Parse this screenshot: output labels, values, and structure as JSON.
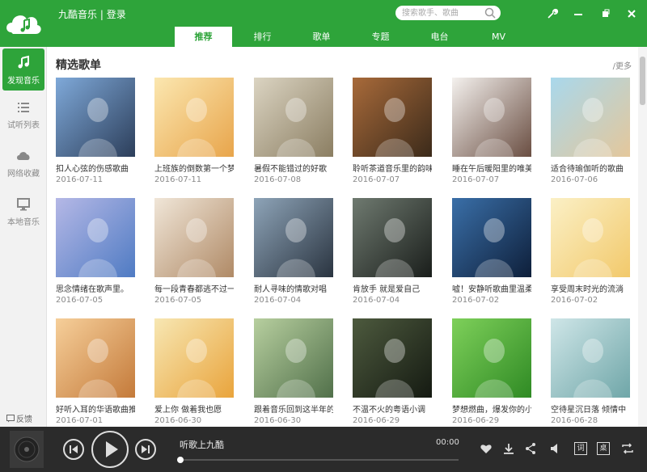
{
  "app": {
    "title": "九酷音乐",
    "login": "登录",
    "search_placeholder": "搜索歌手、歌曲",
    "accent": "#2ea43a"
  },
  "tabs": [
    {
      "label": "推荐",
      "active": true
    },
    {
      "label": "排行",
      "active": false
    },
    {
      "label": "歌单",
      "active": false
    },
    {
      "label": "专题",
      "active": false
    },
    {
      "label": "电台",
      "active": false
    },
    {
      "label": "MV",
      "active": false
    }
  ],
  "sidebar": {
    "items": [
      {
        "label": "发现音乐",
        "icon": "music-note-icon",
        "active": true
      },
      {
        "label": "试听列表",
        "icon": "list-icon",
        "active": false
      },
      {
        "label": "网络收藏",
        "icon": "cloud-icon",
        "active": false
      },
      {
        "label": "本地音乐",
        "icon": "monitor-icon",
        "active": false
      }
    ],
    "feedback": "反馈"
  },
  "main": {
    "section_title": "精选歌单",
    "more": "/更多",
    "playlists": [
      {
        "title": "扣人心弦的伤感歌曲",
        "date": "2016-07-11",
        "c1": "#7fa9d9",
        "c2": "#2c3e5a"
      },
      {
        "title": "上班族的倒数第一个梦",
        "date": "2016-07-11",
        "c1": "#fbe7b0",
        "c2": "#e8a54b"
      },
      {
        "title": "暑假不能错过的好歌",
        "date": "2016-07-08",
        "c1": "#dbd4c2",
        "c2": "#8b7e62"
      },
      {
        "title": "聆听茶道音乐里的韵味",
        "date": "2016-07-07",
        "c1": "#a86a3a",
        "c2": "#3b2a1a"
      },
      {
        "title": "睡在午后暖阳里的唯美",
        "date": "2016-07-07",
        "c1": "#f4f1ee",
        "c2": "#6a4e42"
      },
      {
        "title": "适合待瑜伽听的歌曲",
        "date": "2016-07-06",
        "c1": "#a9d8ec",
        "c2": "#e4c79b"
      },
      {
        "title": "思念情绪在歌声里。",
        "date": "2016-07-05",
        "c1": "#b5b8e6",
        "c2": "#4f7bc3"
      },
      {
        "title": "每一段青春都逃不过一",
        "date": "2016-07-05",
        "c1": "#f0e6d8",
        "c2": "#b08a66"
      },
      {
        "title": "耐人寻味的情歌对唱",
        "date": "2016-07-04",
        "c1": "#8ea4b8",
        "c2": "#2a3440"
      },
      {
        "title": "肯放手 就是爱自己",
        "date": "2016-07-04",
        "c1": "#6f7a70",
        "c2": "#1a1e1b"
      },
      {
        "title": "嘘！安静听歌曲里温柔",
        "date": "2016-07-02",
        "c1": "#3a6fa8",
        "c2": "#0e1f3a"
      },
      {
        "title": "享受周末时光的流淌",
        "date": "2016-07-02",
        "c1": "#fbf0c6",
        "c2": "#f2c96b"
      },
      {
        "title": "好听入耳的华语歌曲推",
        "date": "2016-07-01",
        "c1": "#f6cf9a",
        "c2": "#c47a3a"
      },
      {
        "title": "爱上你 做着我也愿",
        "date": "2016-06-30",
        "c1": "#f7e7b3",
        "c2": "#e9a43c"
      },
      {
        "title": "跟着音乐回到这半年的",
        "date": "2016-06-30",
        "c1": "#b7cf9f",
        "c2": "#51704a"
      },
      {
        "title": "不温不火的粤语小调",
        "date": "2016-06-29",
        "c1": "#4d5a3e",
        "c2": "#151a12"
      },
      {
        "title": "梦想燃曲，爆发你的小",
        "date": "2016-06-29",
        "c1": "#7ed05a",
        "c2": "#2f8a24"
      },
      {
        "title": "空待星沉日落 倾情中",
        "date": "2016-06-28",
        "c1": "#cfe6e8",
        "c2": "#6fa6a8"
      }
    ]
  },
  "player": {
    "now_playing": "听歌上九酷",
    "time": "00:00",
    "progress": 0,
    "lyric_btn": "词",
    "desk_btn": "桌"
  }
}
